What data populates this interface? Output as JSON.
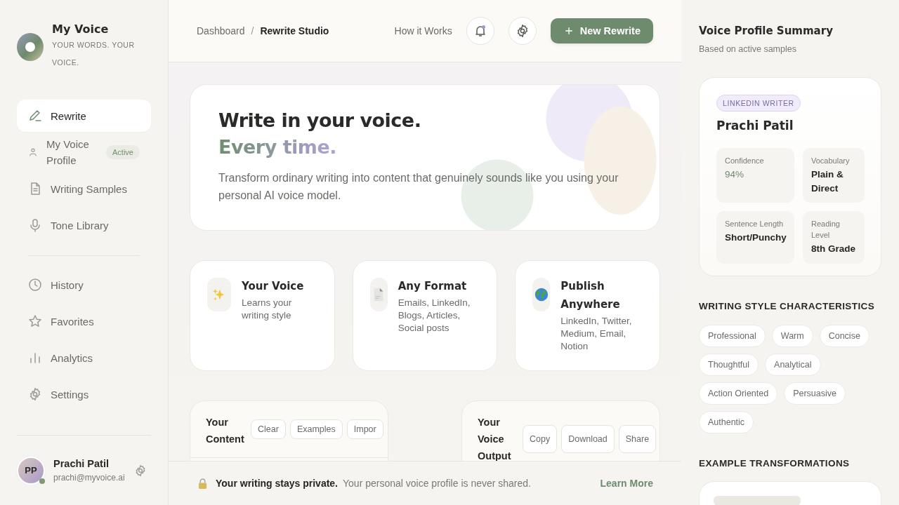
{
  "brand": {
    "title": "My Voice",
    "tagline": "YOUR WORDS. YOUR VOICE."
  },
  "sidebar": {
    "sections": [
      {
        "items": [
          {
            "label": "Rewrite",
            "selected": true
          },
          {
            "label": "My Voice Profile",
            "selected": false,
            "badge": "Active"
          },
          {
            "label": "Writing Samples",
            "selected": false
          },
          {
            "label": "Tone Library",
            "selected": false
          }
        ]
      },
      {
        "items": [
          {
            "label": "History",
            "selected": false
          },
          {
            "label": "Favorites",
            "selected": false
          },
          {
            "label": "Analytics",
            "selected": false
          },
          {
            "label": "Settings",
            "selected": false
          }
        ]
      }
    ]
  },
  "user": {
    "initials": "PP",
    "name": "Prachi Patil",
    "email": "prachi@myvoice.ai",
    "online": true
  },
  "header": {
    "breadcrumb": [
      {
        "label": "Dashboard",
        "current": false
      },
      {
        "label": "Rewrite Studio",
        "current": true
      }
    ],
    "separator": "/",
    "link": "How it Works",
    "notifications_unread": true,
    "primary_button": "New Rewrite"
  },
  "hero": {
    "title": "Write in your voice.",
    "subtitle": "Every time.",
    "text": "Transform ordinary writing into content that genuinely sounds like you using your personal AI voice model."
  },
  "features": [
    {
      "title": "Your Voice",
      "text": "Learns your writing style"
    },
    {
      "title": "Any Format",
      "text": "Emails, LinkedIn, Blogs, Articles, Social posts"
    },
    {
      "title": "Publish Anywhere",
      "text": "LinkedIn, Twitter, Medium, Email, Notion"
    }
  ],
  "editors": [
    {
      "title": "Your Content",
      "actions": [
        "Clear",
        "Examples",
        "Impor"
      ]
    },
    {
      "title": "Your Voice Output",
      "actions": [
        "Copy",
        "Download",
        "Share"
      ]
    }
  ],
  "privacy": {
    "title": "Your writing stays private.",
    "text": "Your personal voice profile is never shared.",
    "link": "Learn More"
  },
  "summary": {
    "title": "Voice Profile Summary",
    "subtitle": "Based on active samples",
    "profile": {
      "badge": "LINKEDIN WRITER",
      "name": "Prachi Patil",
      "stats": [
        {
          "label": "Confidence",
          "value": "94%",
          "highlight": true
        },
        {
          "label": "Vocabulary",
          "value": "Plain & Direct",
          "highlight": false
        },
        {
          "label": "Sentence Length",
          "value": "Short/Punchy",
          "highlight": false
        },
        {
          "label": "Reading Level",
          "value": "8th Grade",
          "highlight": false
        }
      ]
    },
    "characteristics_title": "WRITING STYLE CHARACTERISTICS",
    "characteristics": [
      "Professional",
      "Warm",
      "Concise",
      "Thoughtful",
      "Analytical",
      "Action Oriented",
      "Persuasive",
      "Authentic"
    ],
    "examples_title": "EXAMPLE TRANSFORMATIONS"
  }
}
